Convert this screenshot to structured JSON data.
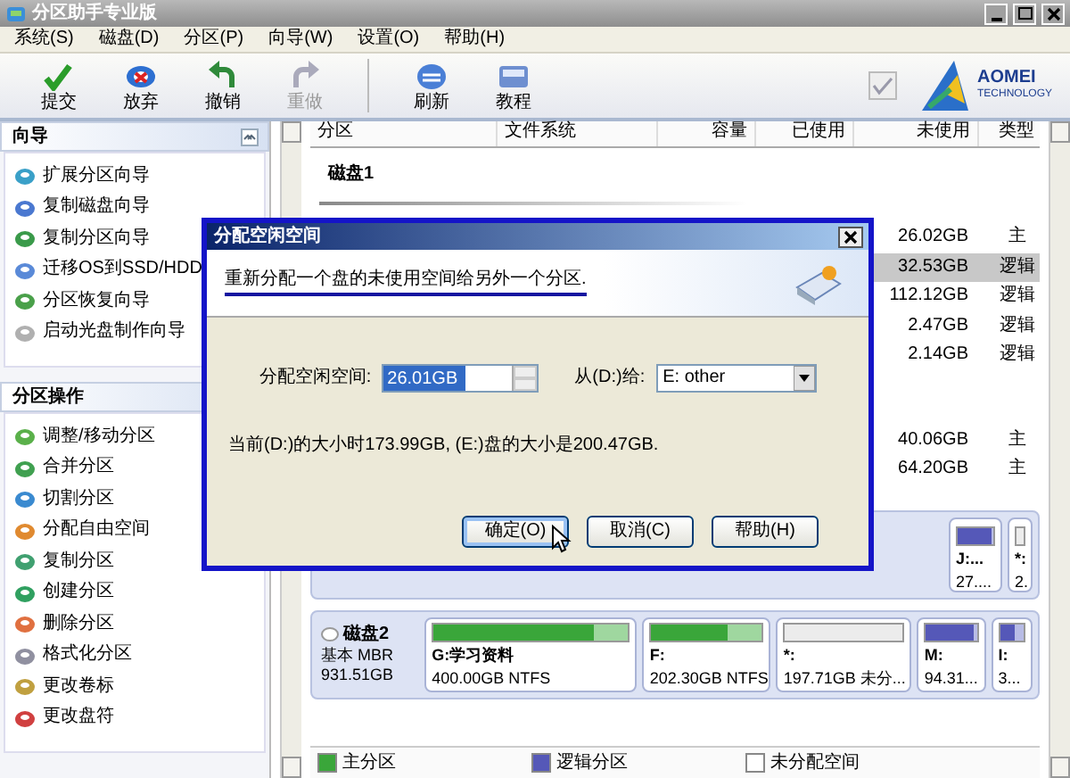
{
  "window": {
    "title": "分区助手专业版"
  },
  "menu": [
    "系统(S)",
    "磁盘(D)",
    "分区(P)",
    "向导(W)",
    "设置(O)",
    "帮助(H)"
  ],
  "toolbar": [
    {
      "label": "提交",
      "kind": "check",
      "disabled": false,
      "separator_before": false
    },
    {
      "label": "放弃",
      "kind": "discard",
      "disabled": false,
      "separator_before": false
    },
    {
      "label": "撤销",
      "kind": "undo",
      "disabled": false,
      "separator_before": false
    },
    {
      "label": "重做",
      "kind": "redo",
      "disabled": true,
      "separator_before": false
    },
    {
      "label": "刷新",
      "kind": "refresh",
      "disabled": false,
      "separator_before": true
    },
    {
      "label": "教程",
      "kind": "book",
      "disabled": false,
      "separator_before": false
    }
  ],
  "logo": {
    "name": "AOMEI",
    "subtitle": "TECHNOLOGY"
  },
  "sidebar": {
    "panels": [
      {
        "title": "向导",
        "items": [
          "扩展分区向导",
          "复制磁盘向导",
          "复制分区向导",
          "迁移OS到SSD/HDD",
          "分区恢复向导",
          "启动光盘制作向导"
        ]
      },
      {
        "title": "分区操作",
        "items": [
          "调整/移动分区",
          "合并分区",
          "切割分区",
          "分配自由空间",
          "复制分区",
          "创建分区",
          "删除分区",
          "格式化分区",
          "更改卷标",
          "更改盘符"
        ]
      }
    ]
  },
  "table": {
    "columns": [
      "分区",
      "文件系统",
      "容量",
      "已使用",
      "未使用",
      "类型"
    ],
    "disk_label": "磁盘1",
    "row_groups": [
      [
        {
          "unused": "26.02GB",
          "type": "主",
          "selected": false
        },
        {
          "unused": "32.53GB",
          "type": "逻辑",
          "selected": true
        },
        {
          "unused": "112.12GB",
          "type": "逻辑",
          "selected": false
        },
        {
          "unused": "2.47GB",
          "type": "逻辑",
          "selected": false
        },
        {
          "unused": "2.14GB",
          "type": "逻辑",
          "selected": false
        }
      ],
      [
        {
          "unused": "40.06GB",
          "type": "主",
          "selected": false
        },
        {
          "unused": "64.20GB",
          "type": "主",
          "selected": false
        }
      ]
    ]
  },
  "disk_map": [
    {
      "partitions": [
        {
          "name": "J:...",
          "detail": "27....",
          "kind": "logical",
          "level": 0.95
        },
        {
          "name": "*:",
          "detail": "2.",
          "kind": "unallocated"
        }
      ]
    },
    {
      "label": "磁盘2",
      "subtitle": "基本 MBR",
      "size": "931.51GB",
      "partitions": [
        {
          "name": "G:学习资料",
          "detail": "400.00GB NTFS",
          "kind": "primary",
          "level": 0.82
        },
        {
          "name": "F:",
          "detail": "202.30GB NTFS",
          "kind": "primary",
          "level": 0.68
        },
        {
          "name": "*:",
          "detail": "197.71GB 未分...",
          "kind": "unallocated"
        },
        {
          "name": "M:",
          "detail": "94.31...",
          "kind": "logical",
          "level": 0.95
        },
        {
          "name": "I:",
          "detail": "3...",
          "kind": "logical",
          "level": 0.6
        }
      ]
    }
  ],
  "legend": [
    {
      "label": "主分区",
      "kind": "primary"
    },
    {
      "label": "逻辑分区",
      "kind": "logical"
    },
    {
      "label": "未分配空间",
      "kind": "unallocated"
    }
  ],
  "dialog": {
    "title": "分配空闲空间",
    "header": "重新分配一个盘的未使用空间给另外一个分区.",
    "size_label": "分配空闲空间:",
    "size_value": "26.01GB",
    "from_label": "从(D:)给:",
    "from_value": "E: other",
    "info": "当前(D:)的大小时173.99GB, (E:)盘的大小是200.47GB.",
    "buttons": [
      {
        "label": "确定(O)",
        "focused": true
      },
      {
        "label": "取消(C)",
        "focused": false
      },
      {
        "label": "帮助(H)",
        "focused": false
      }
    ]
  }
}
